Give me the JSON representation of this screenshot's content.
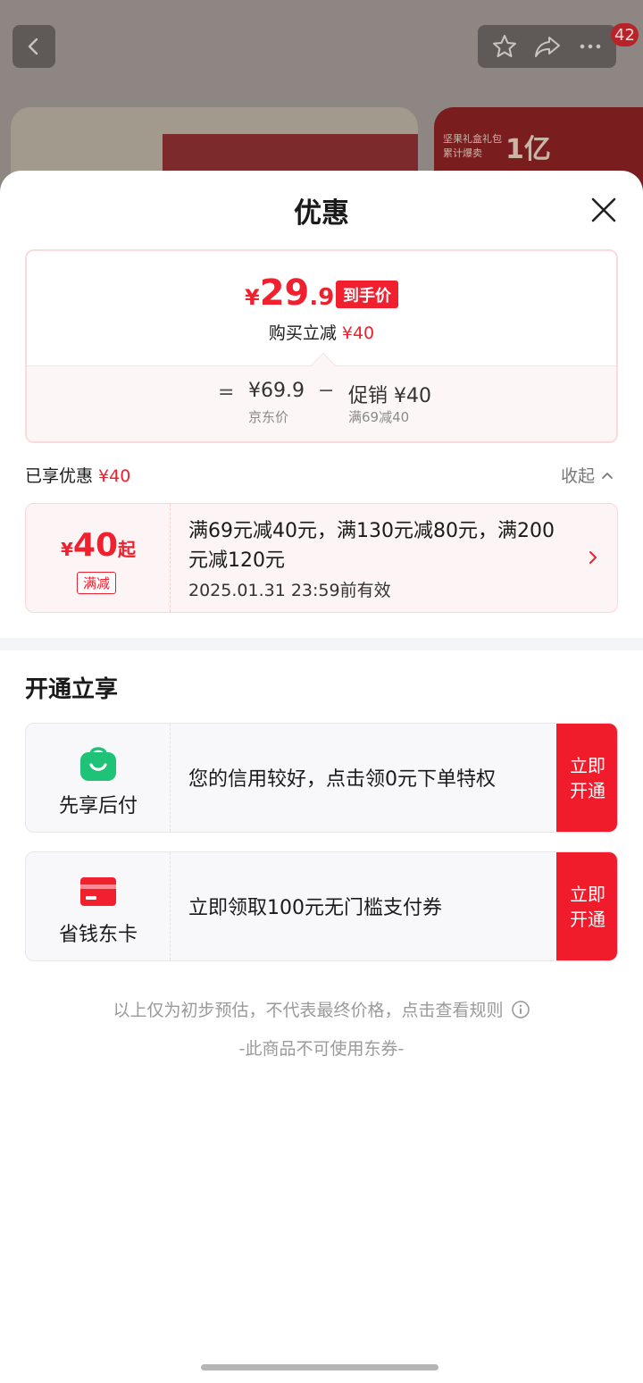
{
  "background": {
    "notification_count": "42",
    "card2_caption": "坚果礼盒礼包 累计爆卖",
    "card2_big": "1亿"
  },
  "sheet": {
    "title": "优惠",
    "price": {
      "currency": "¥",
      "integer": "29",
      "decimal": ".9",
      "tag": "到手价",
      "buy_minus_label": "购买立减",
      "buy_minus_amount": "¥40",
      "equals": "=",
      "jd_price": "¥69.9",
      "jd_label": "京东价",
      "minus": "−",
      "promo_value": "促销 ¥40",
      "promo_label": "满69减40"
    },
    "enjoyed": {
      "label": "已享优惠",
      "amount": "¥40",
      "collapse": "收起"
    },
    "coupon": {
      "currency": "¥",
      "amount": "40",
      "suffix": "起",
      "type_tag": "满减",
      "description": "满69元减40元，满130元减80元，满200元减120元",
      "validity": "2025.01.31 23:59前有效"
    },
    "section_title": "开通立享",
    "services": [
      {
        "name": "先享后付",
        "description": "您的信用较好，点击领0元下单特权",
        "button": "立即开通",
        "icon": "shopping-bag-icon",
        "icon_color": "#1fc378"
      },
      {
        "name": "省钱东卡",
        "description": "立即领取100元无门槛支付券",
        "button": "立即开通",
        "icon": "card-icon",
        "icon_color": "#f0202f"
      }
    ],
    "disclaimer": "以上仅为初步预估，不代表最终价格，点击查看规则",
    "no_coupon": "-此商品不可使用东券-"
  },
  "colors": {
    "accent_red": "#f0202f",
    "green": "#1fc378"
  }
}
